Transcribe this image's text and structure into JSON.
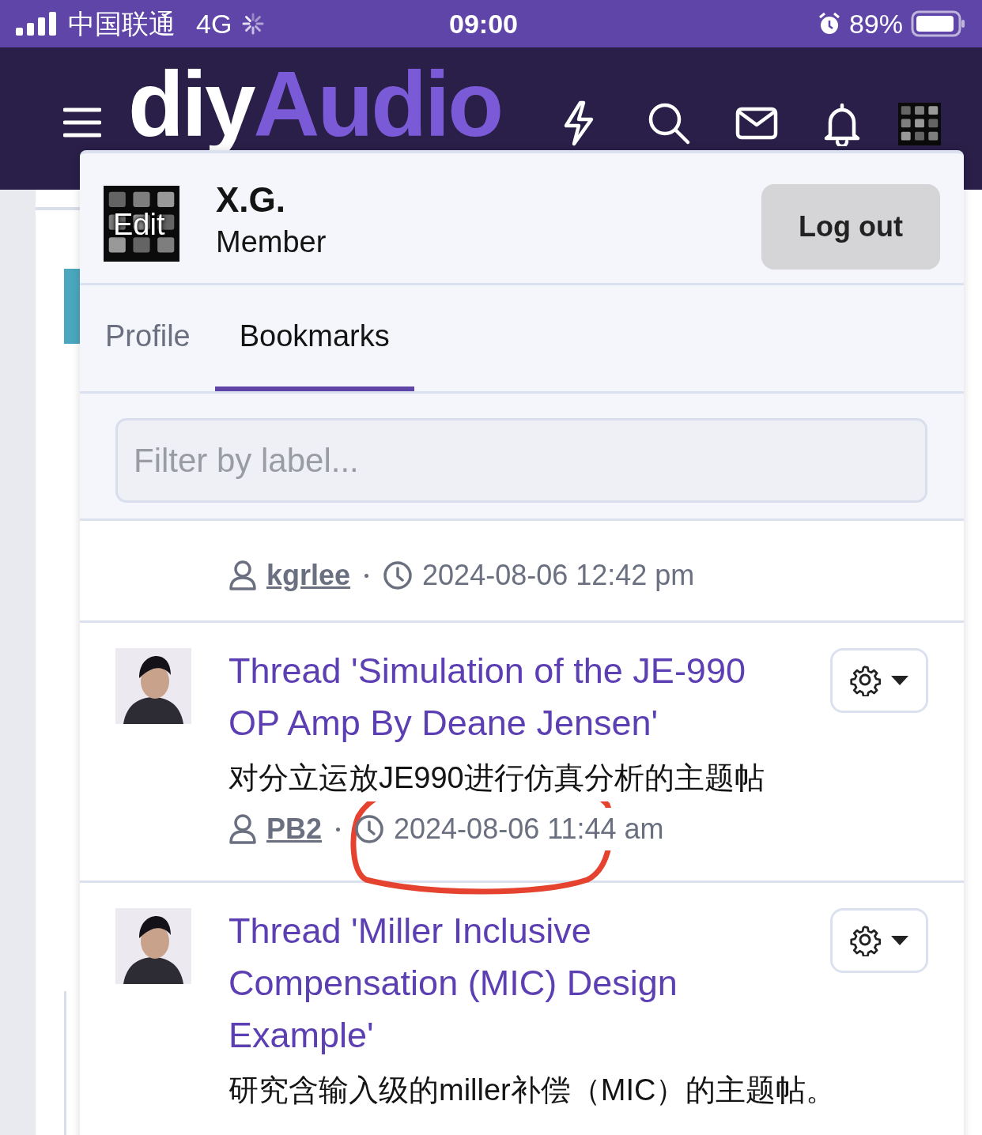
{
  "status_bar": {
    "carrier": "中国联通",
    "network": "4G",
    "time": "09:00",
    "battery": "89%"
  },
  "header": {
    "logo_left": "diy",
    "logo_right": "Audio"
  },
  "account_menu": {
    "user": {
      "name": "X.G.",
      "role": "Member",
      "avatar_label": "Edit"
    },
    "logout": "Log out",
    "tabs": [
      {
        "label": "Profile",
        "selected": false
      },
      {
        "label": "Bookmarks",
        "selected": true
      }
    ],
    "filter": {
      "placeholder": "Filter by label..."
    },
    "bookmarks": [
      {
        "author": "kgrlee",
        "time": "2024-08-06 12:42 pm"
      },
      {
        "title": "Thread 'Simulation of the JE-990 OP Amp By Deane Jensen'",
        "description": "对分立运放JE990进行仿真分析的主题帖",
        "author": "PB2",
        "time": "2024-08-06 11:44 am",
        "annotation": {
          "kind": "hand-drawn-circle",
          "color": "#e5432f"
        }
      },
      {
        "title": "Thread 'Miller Inclusive Compensation (MIC) Design Example'",
        "description": "研究含输入级的miller补偿（MIC）的主题帖。"
      }
    ]
  }
}
